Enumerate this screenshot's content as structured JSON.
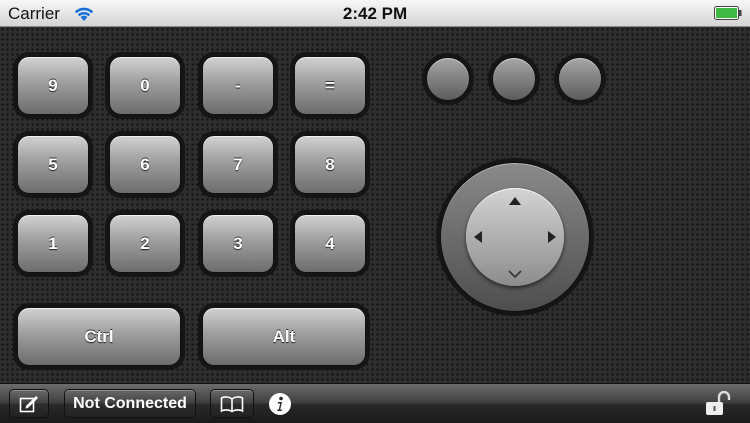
{
  "status_bar": {
    "carrier": "Carrier",
    "time": "2:42 PM",
    "battery_color": "#3fb944"
  },
  "keypad": {
    "row1": [
      "9",
      "0",
      "-",
      "="
    ],
    "row2": [
      "5",
      "6",
      "7",
      "8"
    ],
    "row3": [
      "1",
      "2",
      "3",
      "4"
    ],
    "modifiers": [
      "Ctrl",
      "Alt"
    ]
  },
  "toolbar": {
    "connection_status": "Not Connected",
    "icons": [
      "edit-icon",
      "bookmarks-icon",
      "info-icon",
      "unlock-icon"
    ]
  }
}
